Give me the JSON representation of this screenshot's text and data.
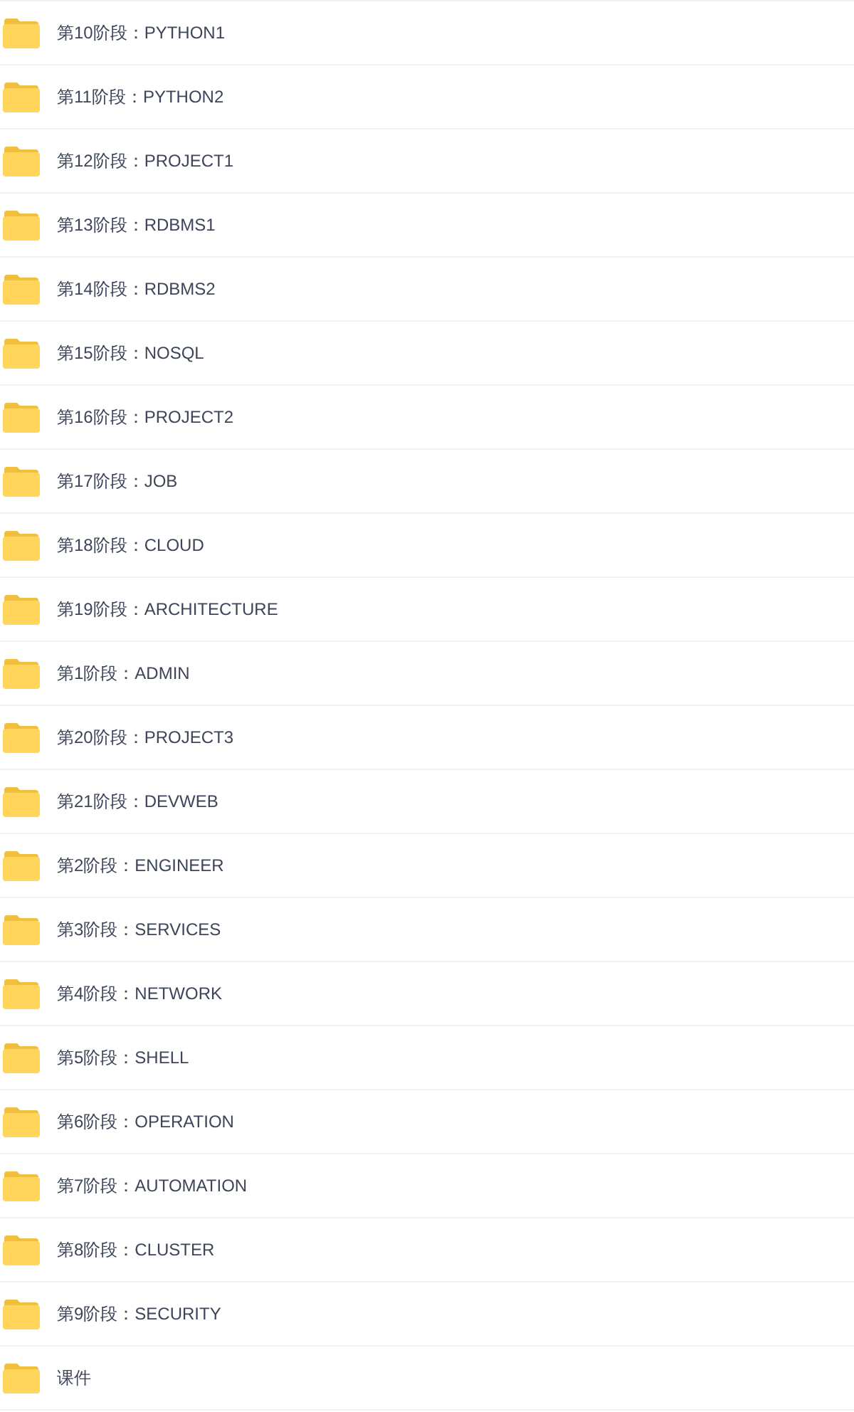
{
  "folders": [
    {
      "name": "第10阶段：PYTHON1"
    },
    {
      "name": "第11阶段：PYTHON2"
    },
    {
      "name": "第12阶段：PROJECT1"
    },
    {
      "name": "第13阶段：RDBMS1"
    },
    {
      "name": "第14阶段：RDBMS2"
    },
    {
      "name": "第15阶段：NOSQL"
    },
    {
      "name": "第16阶段：PROJECT2"
    },
    {
      "name": "第17阶段：JOB"
    },
    {
      "name": "第18阶段：CLOUD"
    },
    {
      "name": "第19阶段：ARCHITECTURE"
    },
    {
      "name": "第1阶段：ADMIN"
    },
    {
      "name": "第20阶段：PROJECT3"
    },
    {
      "name": "第21阶段：DEVWEB"
    },
    {
      "name": "第2阶段：ENGINEER"
    },
    {
      "name": "第3阶段：SERVICES"
    },
    {
      "name": "第4阶段：NETWORK"
    },
    {
      "name": "第5阶段：SHELL"
    },
    {
      "name": "第6阶段：OPERATION"
    },
    {
      "name": "第7阶段：AUTOMATION"
    },
    {
      "name": "第8阶段：CLUSTER"
    },
    {
      "name": "第9阶段：SECURITY"
    },
    {
      "name": "课件"
    }
  ]
}
